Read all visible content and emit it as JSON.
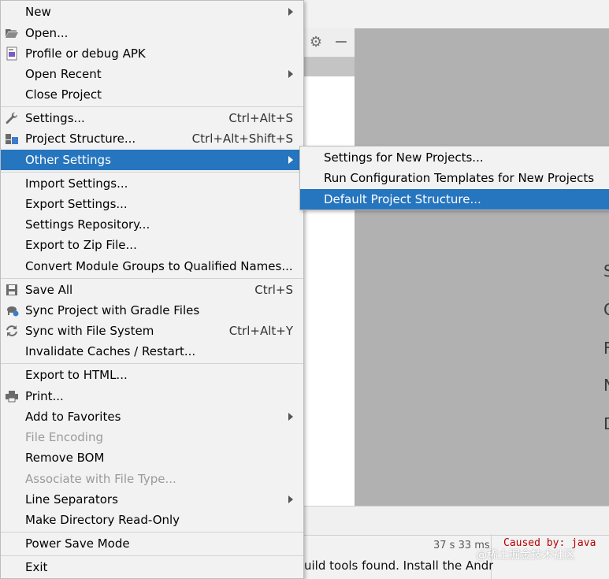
{
  "file_menu": {
    "items": {
      "new": {
        "label": "New"
      },
      "open": {
        "label": "Open..."
      },
      "profile_debug_apk": {
        "label": "Profile or debug APK"
      },
      "open_recent": {
        "label": "Open Recent"
      },
      "close_project": {
        "label": "Close Project"
      },
      "settings": {
        "label": "Settings...",
        "shortcut": "Ctrl+Alt+S"
      },
      "project_structure": {
        "label": "Project Structure...",
        "shortcut": "Ctrl+Alt+Shift+S"
      },
      "other_settings": {
        "label": "Other Settings"
      },
      "import_settings": {
        "label": "Import Settings..."
      },
      "export_settings": {
        "label": "Export Settings..."
      },
      "settings_repository": {
        "label": "Settings Repository..."
      },
      "export_zip": {
        "label": "Export to Zip File..."
      },
      "convert_module_groups": {
        "label": "Convert Module Groups to Qualified Names..."
      },
      "save_all": {
        "label": "Save All",
        "shortcut": "Ctrl+S"
      },
      "sync_gradle": {
        "label": "Sync Project with Gradle Files"
      },
      "sync_file_system": {
        "label": "Sync with File System",
        "shortcut": "Ctrl+Alt+Y"
      },
      "invalidate_caches": {
        "label": "Invalidate Caches / Restart..."
      },
      "export_html": {
        "label": "Export to HTML..."
      },
      "print": {
        "label": "Print..."
      },
      "add_favorites": {
        "label": "Add to Favorites"
      },
      "file_encoding": {
        "label": "File Encoding"
      },
      "remove_bom": {
        "label": "Remove BOM"
      },
      "associate_file_type": {
        "label": "Associate with File Type..."
      },
      "line_separators": {
        "label": "Line Separators"
      },
      "make_read_only": {
        "label": "Make Directory Read-Only"
      },
      "power_save": {
        "label": "Power Save Mode"
      },
      "exit": {
        "label": "Exit"
      }
    }
  },
  "submenu": {
    "items": {
      "settings_new_projects": {
        "label": "Settings for New Projects..."
      },
      "run_config_templates": {
        "label": "Run Configuration Templates for New Projects"
      },
      "default_project_structure": {
        "label": "Default Project Structure..."
      }
    }
  },
  "background": {
    "editor_glyphs": [
      "S",
      "C",
      "F",
      "N",
      "D"
    ],
    "build_time": "37 s 33 ms",
    "console_text": "Caused by: java",
    "build_line": "uild tools found. Install the Andro",
    "watermark": "@稀土掘金技术社区"
  },
  "colors": {
    "menu_bg": "#f2f2f2",
    "selection": "#2675bf",
    "disabled_text": "#9a9a9a",
    "editor_bg": "#b1b1b1",
    "console_error": "#b80000"
  },
  "icons": {
    "open": "folder-open-icon",
    "profile_apk": "apk-icon",
    "settings": "wrench-icon",
    "project_structure": "project-structure-icon",
    "save_all": "save-icon",
    "sync_gradle": "gradle-sync-icon",
    "sync_fs": "refresh-icon",
    "print": "printer-icon",
    "gear": "gear-icon",
    "minimize": "minus-icon"
  }
}
